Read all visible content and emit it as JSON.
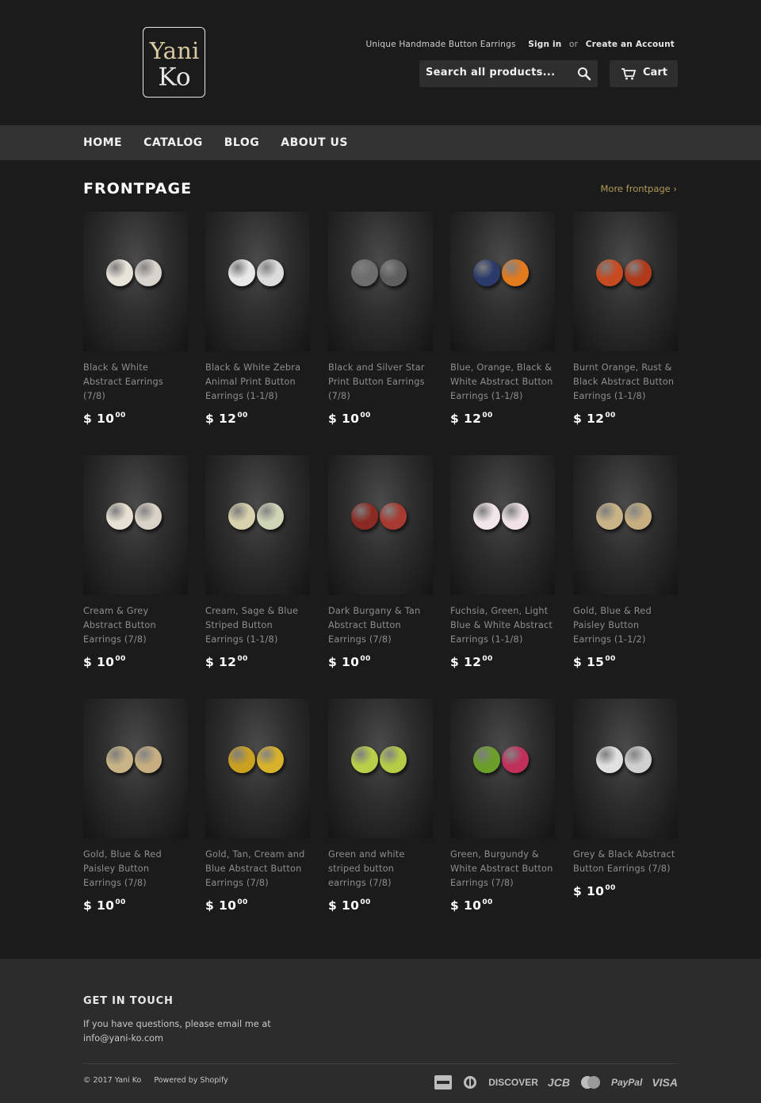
{
  "header": {
    "logo_text_line1": "Yani",
    "logo_text_line2": "Ko",
    "tagline": "Unique Handmade Button Earrings",
    "signin_label": "Sign in",
    "or_label": "or",
    "create_account_label": "Create an Account",
    "search_placeholder": "Search all products...",
    "cart_label": "Cart"
  },
  "nav": {
    "items": [
      {
        "label": "HOME"
      },
      {
        "label": "CATALOG"
      },
      {
        "label": "BLOG"
      },
      {
        "label": "ABOUT US"
      }
    ]
  },
  "main": {
    "title": "FRONTPAGE",
    "more_link": "More frontpage ›",
    "products": [
      {
        "title": "Black & White Abstract Earrings (7/8)",
        "price": "$ 10",
        "cents": "00",
        "colors": [
          "#e8e4da",
          "#d8d4cc"
        ]
      },
      {
        "title": "Black & White Zebra Animal Print Button Earrings (1-1/8)",
        "price": "$ 12",
        "cents": "00",
        "colors": [
          "#e8e8e8",
          "#dcdcdc"
        ]
      },
      {
        "title": "Black and Silver Star Print Button Earrings (7/8)",
        "price": "$ 10",
        "cents": "00",
        "colors": [
          "#6d6d6d",
          "#5e5e5e"
        ]
      },
      {
        "title": "Blue, Orange, Black & White Abstract Button Earrings (1-1/8)",
        "price": "$ 12",
        "cents": "00",
        "colors": [
          "#2a3a6a",
          "#e27a1e"
        ]
      },
      {
        "title": "Burnt Orange, Rust & Black Abstract Button Earrings (1-1/8)",
        "price": "$ 12",
        "cents": "00",
        "colors": [
          "#c84a20",
          "#b03a1a"
        ]
      },
      {
        "title": "Cream & Grey Abstract Button Earrings (7/8)",
        "price": "$ 10",
        "cents": "00",
        "colors": [
          "#e8e0d4",
          "#dad2c6"
        ]
      },
      {
        "title": "Cream, Sage & Blue Striped Button Earrings (1-1/8)",
        "price": "$ 12",
        "cents": "00",
        "colors": [
          "#d9d2ae",
          "#cfd6b8"
        ]
      },
      {
        "title": "Dark Burgany & Tan Abstract Button Earrings (7/8)",
        "price": "$ 10",
        "cents": "00",
        "colors": [
          "#8a2a22",
          "#a63a30"
        ]
      },
      {
        "title": "Fuchsia, Green, Light Blue & White Abstract Earrings (1-1/8)",
        "price": "$ 12",
        "cents": "00",
        "colors": [
          "#f2e6ea",
          "#f0e2e6"
        ]
      },
      {
        "title": "Gold, Blue & Red Paisley Button Earrings (1-1/2)",
        "price": "$ 15",
        "cents": "00",
        "colors": [
          "#c8b486",
          "#c6ae80"
        ]
      },
      {
        "title": "Gold, Blue & Red Paisley Button Earrings (7/8)",
        "price": "$ 10",
        "cents": "00",
        "colors": [
          "#c8b486",
          "#c6ae80"
        ]
      },
      {
        "title": "Gold, Tan, Cream and Blue Abstract Button Earrings (7/8)",
        "price": "$ 10",
        "cents": "00",
        "colors": [
          "#c9a020",
          "#d8b22a"
        ]
      },
      {
        "title": "Green and white striped button earrings (7/8)",
        "price": "$ 10",
        "cents": "00",
        "colors": [
          "#b8cf4a",
          "#b4cc46"
        ]
      },
      {
        "title": "Green, Burgundy & White Abstract Button Earrings (7/8)",
        "price": "$ 10",
        "cents": "00",
        "colors": [
          "#6aa02a",
          "#c0305a"
        ]
      },
      {
        "title": "Grey & Black Abstract Button Earrings (7/8)",
        "price": "$ 10",
        "cents": "00",
        "colors": [
          "#e0e0e0",
          "#d0d0d0"
        ]
      }
    ]
  },
  "footer": {
    "heading": "GET IN TOUCH",
    "text": "If you have questions, please email me at info@yani-ko.com",
    "copyright": "© 2017 Yani Ko",
    "powered": "Powered by Shopify",
    "payments": [
      "DISCOVER",
      "JCB",
      "PayPal",
      "VISA"
    ]
  }
}
